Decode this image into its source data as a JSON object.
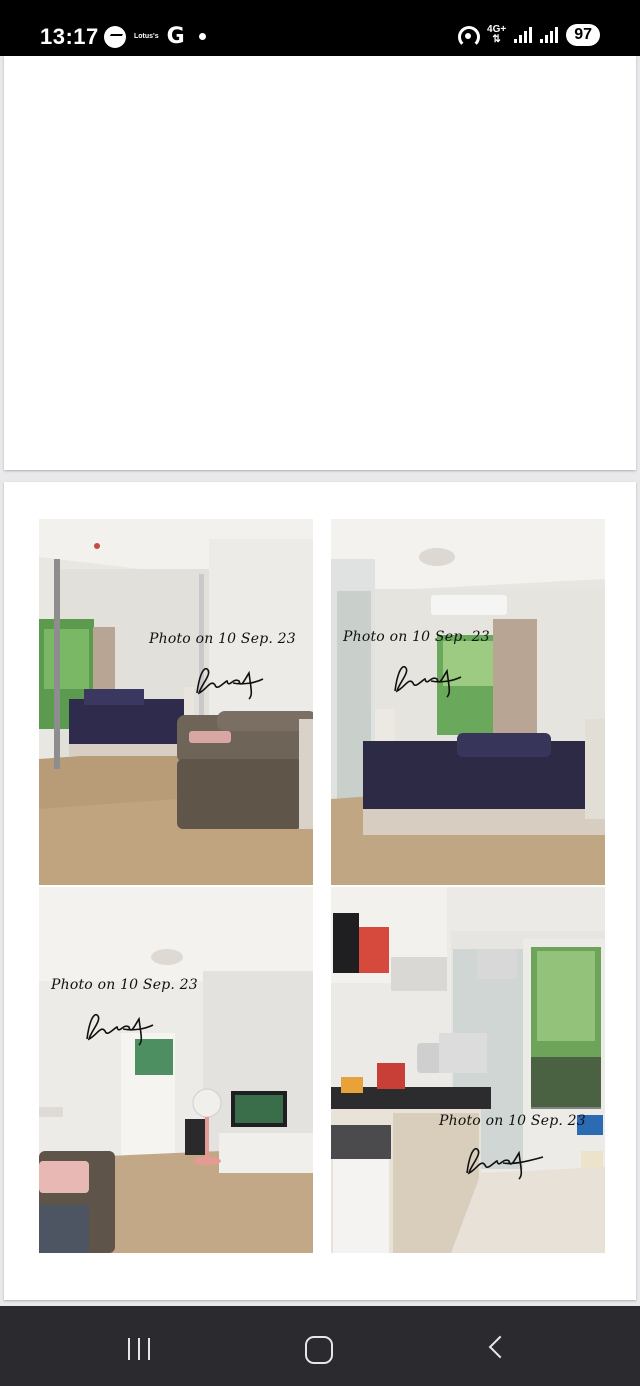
{
  "status_bar": {
    "time": "13:17",
    "messenger_icon": "messenger-icon",
    "app_notification": "Lotus's",
    "google_icon_glyph": "G",
    "network_type": "4G+",
    "battery": "97"
  },
  "listing": {
    "photos": [
      {
        "caption": "Photo on 10 Sep. 23"
      },
      {
        "caption": "Photo on 10 Sep. 23"
      },
      {
        "caption": "Photo on 10 Sep. 23"
      },
      {
        "caption": "Photo on 10 Sep. 23"
      }
    ]
  },
  "nav_bar": {
    "recent_icon": "recent-apps-icon",
    "home_icon": "home-icon",
    "back_icon": "back-icon"
  }
}
